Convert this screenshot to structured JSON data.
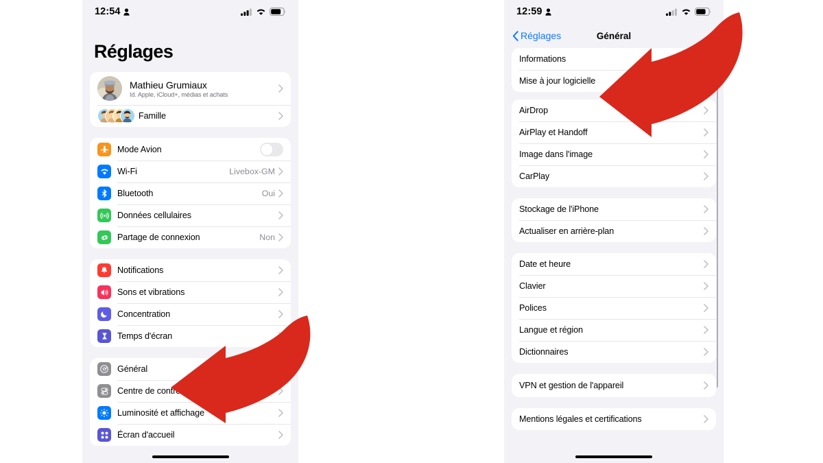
{
  "left_phone": {
    "status_bar": {
      "time": "12:54",
      "location_icon": "person-icon",
      "signal_icon": "cellular-signal-icon",
      "wifi_icon": "wifi-icon",
      "battery_icon": "battery-icon"
    },
    "page_title": "Réglages",
    "account": {
      "name": "Mathieu Grumiaux",
      "subtitle": "Id. Apple, iCloud+, médias et achats",
      "family_label": "Famille"
    },
    "groups": [
      {
        "rows": [
          {
            "label": "Mode Avion",
            "icon": "airplane-icon",
            "icon_color": "#f7941e",
            "control": "toggle",
            "toggle_on": false
          },
          {
            "label": "Wi-Fi",
            "icon": "wifi-icon",
            "icon_color": "#007aff",
            "value": "Livebox-GM",
            "control": "chevron"
          },
          {
            "label": "Bluetooth",
            "icon": "bluetooth-icon",
            "icon_color": "#007aff",
            "value": "Oui",
            "control": "chevron"
          },
          {
            "label": "Données cellulaires",
            "icon": "cellular-icon",
            "icon_color": "#34c759",
            "value": "",
            "control": "chevron"
          },
          {
            "label": "Partage de connexion",
            "icon": "hotspot-icon",
            "icon_color": "#34c759",
            "value": "Non",
            "control": "chevron"
          }
        ]
      },
      {
        "rows": [
          {
            "label": "Notifications",
            "icon": "bell-icon",
            "icon_color": "#ff3b30",
            "control": "chevron"
          },
          {
            "label": "Sons et vibrations",
            "icon": "speaker-icon",
            "icon_color": "#f8325a",
            "control": "chevron"
          },
          {
            "label": "Concentration",
            "icon": "moon-icon",
            "icon_color": "#5e5ce6",
            "control": "chevron"
          },
          {
            "label": "Temps d'écran",
            "icon": "hourglass-icon",
            "icon_color": "#5856d6",
            "control": "chevron"
          }
        ]
      },
      {
        "rows": [
          {
            "label": "Général",
            "icon": "gear-icon",
            "icon_color": "#8e8e93",
            "control": "chevron"
          },
          {
            "label": "Centre de contrôle",
            "icon": "control-center-icon",
            "icon_color": "#8e8e93",
            "control": "chevron"
          },
          {
            "label": "Luminosité et affichage",
            "icon": "brightness-icon",
            "icon_color": "#007aff",
            "control": "chevron"
          },
          {
            "label": "Écran d'accueil",
            "icon": "home-screen-icon",
            "icon_color": "#5856d6",
            "control": "chevron"
          }
        ]
      }
    ]
  },
  "right_phone": {
    "status_bar": {
      "time": "12:59",
      "location_icon": "person-icon",
      "signal_icon": "cellular-signal-icon",
      "wifi_icon": "wifi-icon",
      "battery_icon": "battery-icon"
    },
    "nav": {
      "back_label": "Réglages",
      "back_icon": "chevron-left-icon",
      "title": "Général"
    },
    "groups": [
      {
        "rows": [
          {
            "label": "Informations"
          },
          {
            "label": "Mise à jour logicielle"
          }
        ]
      },
      {
        "rows": [
          {
            "label": "AirDrop"
          },
          {
            "label": "AirPlay et Handoff"
          },
          {
            "label": "Image dans l'image"
          },
          {
            "label": "CarPlay"
          }
        ]
      },
      {
        "rows": [
          {
            "label": "Stockage de l'iPhone"
          },
          {
            "label": "Actualiser en arrière-plan"
          }
        ]
      },
      {
        "rows": [
          {
            "label": "Date et heure"
          },
          {
            "label": "Clavier"
          },
          {
            "label": "Polices"
          },
          {
            "label": "Langue et région"
          },
          {
            "label": "Dictionnaires"
          }
        ]
      },
      {
        "rows": [
          {
            "label": "VPN et gestion de l'appareil"
          }
        ]
      },
      {
        "rows": [
          {
            "label": "Mentions légales et certifications"
          }
        ]
      }
    ]
  },
  "annotations": {
    "arrow_color": "#d9291c",
    "arrows": [
      {
        "name": "arrow-pointing-to-general",
        "points_to": "Général"
      },
      {
        "name": "arrow-pointing-to-software-update",
        "points_to": "Mise à jour logicielle"
      }
    ]
  }
}
